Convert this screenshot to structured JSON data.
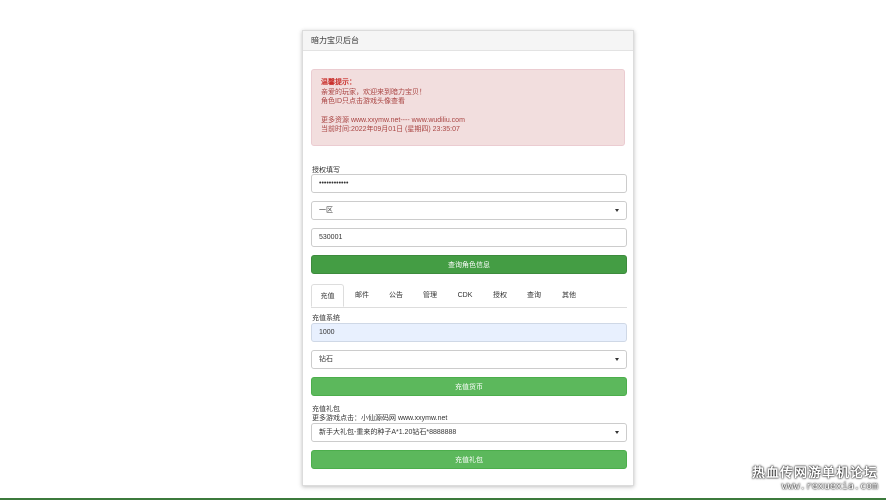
{
  "panel": {
    "title": "暗力宝贝后台"
  },
  "notice": {
    "title": "温馨提示：",
    "line1": "亲爱的玩家，欢迎来到暗力宝贝！",
    "line2": "角色ID只点击游戏头像查看",
    "line3": "更多资源 www.xxymw.net---- www.wudiliu.com",
    "line4": "当前时间:2022年09月01日 (星期四) 23:35:07"
  },
  "auth": {
    "label": "授权填写",
    "password_value": "••••••••••••"
  },
  "server": {
    "selected": "一区"
  },
  "role_id": {
    "value": "530001"
  },
  "query_button": {
    "label": "查询角色信息"
  },
  "tabs": [
    "充值",
    "邮件",
    "公告",
    "管理",
    "CDK",
    "授权",
    "查询",
    "其他"
  ],
  "recharge": {
    "label": "充值系统",
    "amount": "1000",
    "type_selected": "钻石",
    "button": "充值货币"
  },
  "gift": {
    "label": "充值礼包",
    "note": "更多游戏点击：小仙源码网 www.xxymw.net",
    "selected": "新手大礼包-重来的种子A*1.20钻石*8888888",
    "button": "充值礼包"
  },
  "watermark": {
    "line1": "热血传网游单机论坛",
    "line2": "www.rexuexia.com"
  }
}
